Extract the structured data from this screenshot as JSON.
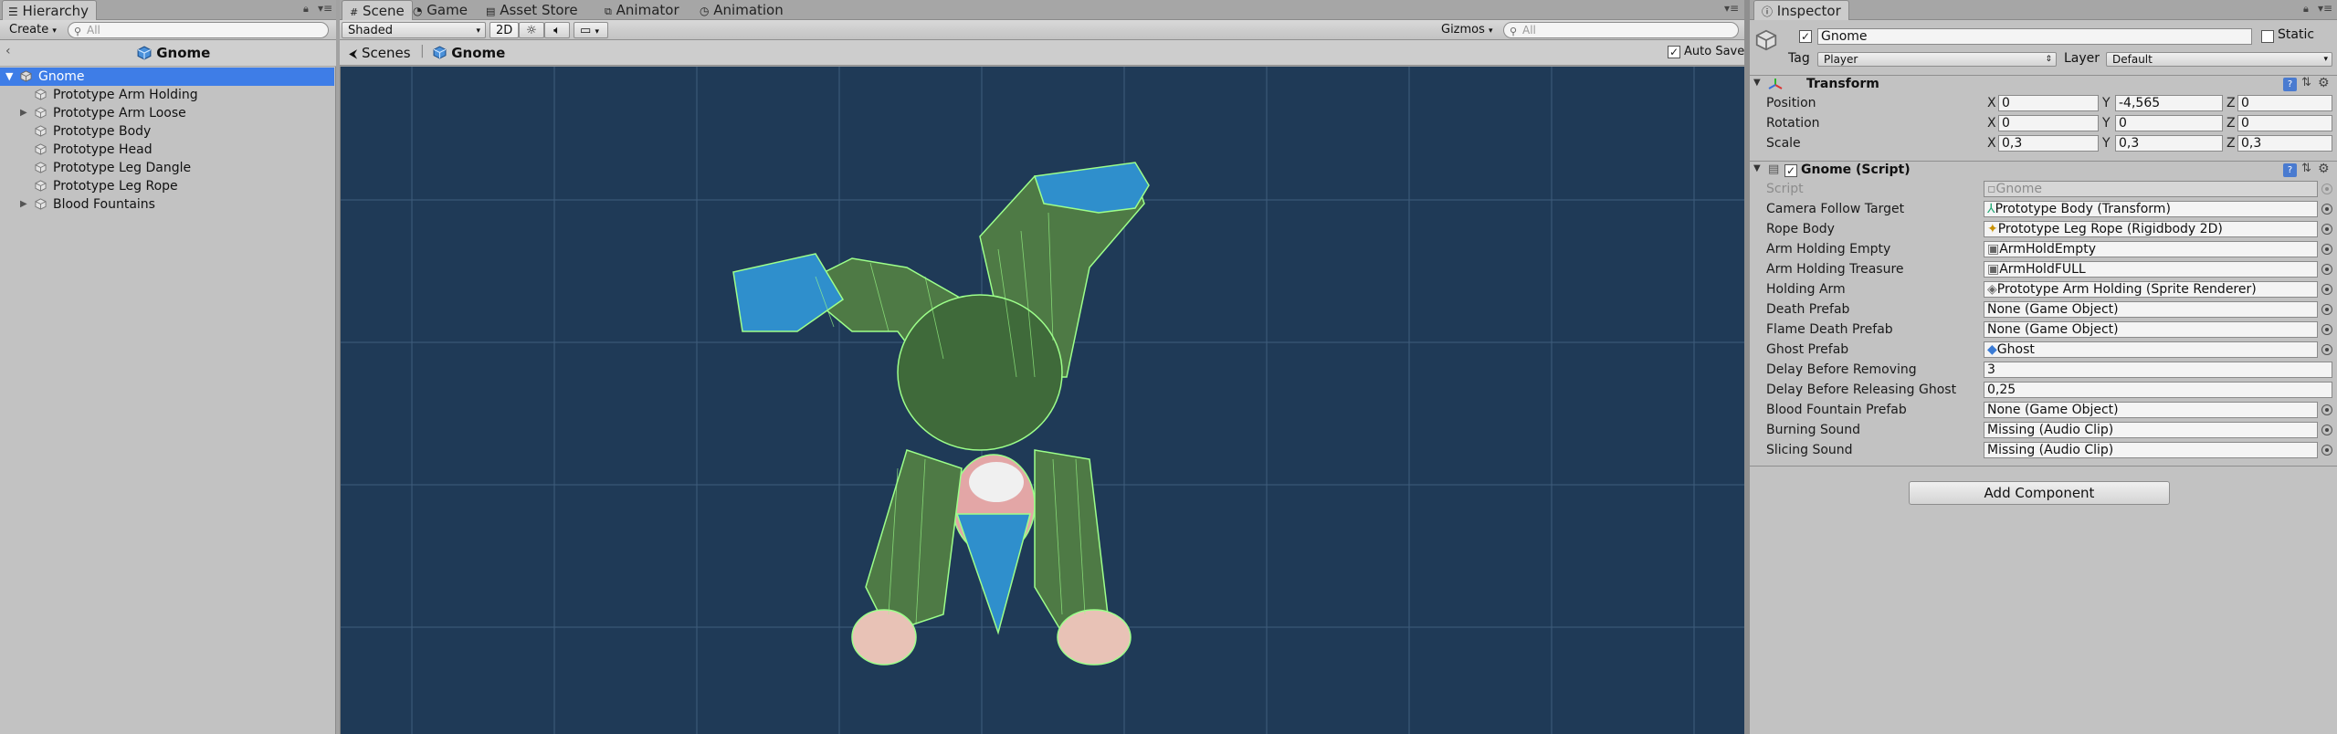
{
  "hierarchy": {
    "tab_label": "Hierarchy",
    "create_label": "Create",
    "search_placeholder": "All",
    "scene_name": "Gnome",
    "items": [
      {
        "label": "Gnome",
        "expanded": true,
        "selected": true
      },
      {
        "label": "Prototype Arm Holding"
      },
      {
        "label": "Prototype Arm Loose",
        "has_children": true
      },
      {
        "label": "Prototype Body"
      },
      {
        "label": "Prototype Head"
      },
      {
        "label": "Prototype Leg Dangle"
      },
      {
        "label": "Prototype Leg Rope"
      },
      {
        "label": "Blood Fountains",
        "has_children": true
      }
    ]
  },
  "scene_tabs": [
    {
      "label": "Scene",
      "icon": "grid-icon",
      "active": true
    },
    {
      "label": "Game",
      "icon": "pacman-icon"
    },
    {
      "label": "Asset Store",
      "icon": "store-icon"
    },
    {
      "label": "Animator",
      "icon": "animator-icon"
    },
    {
      "label": "Animation",
      "icon": "clock-icon"
    }
  ],
  "scene_toolbar": {
    "shading_mode": "Shaded",
    "mode_2d": "2D",
    "gizmos": "Gizmos",
    "search_placeholder": "All"
  },
  "breadcrumb": {
    "root": "Scenes",
    "current": "Gnome",
    "auto_save_label": "Auto Save",
    "auto_save_checked": true
  },
  "inspector": {
    "tab_label": "Inspector",
    "object_name": "Gnome",
    "static_label": "Static",
    "tag_label": "Tag",
    "tag_value": "Player",
    "layer_label": "Layer",
    "layer_value": "Default",
    "transform": {
      "title": "Transform",
      "rows": [
        {
          "label": "Position",
          "x": "0",
          "y": "-4,565",
          "z": "0"
        },
        {
          "label": "Rotation",
          "x": "0",
          "y": "0",
          "z": "0"
        },
        {
          "label": "Scale",
          "x": "0,3",
          "y": "0,3",
          "z": "0,3"
        }
      ],
      "axis_x": "X",
      "axis_y": "Y",
      "axis_z": "Z"
    },
    "script_component": {
      "title": "Gnome (Script)",
      "properties": [
        {
          "label": "Script",
          "value": "Gnome",
          "disabled": true
        },
        {
          "label": "Camera Follow Target",
          "value": "Prototype Body (Transform)"
        },
        {
          "label": "Rope Body",
          "value": "Prototype Leg Rope (Rigidbody 2D)"
        },
        {
          "label": "Arm Holding Empty",
          "value": "ArmHoldEmpty"
        },
        {
          "label": "Arm Holding Treasure",
          "value": "ArmHoldFULL"
        },
        {
          "label": "Holding Arm",
          "value": "Prototype Arm Holding (Sprite Renderer)"
        },
        {
          "label": "Death Prefab",
          "value": "None (Game Object)"
        },
        {
          "label": "Flame Death Prefab",
          "value": "None (Game Object)"
        },
        {
          "label": "Ghost Prefab",
          "value": "Ghost"
        },
        {
          "label": "Delay Before Removing",
          "value": "3"
        },
        {
          "label": "Delay Before Releasing Ghost",
          "value": "0,25"
        },
        {
          "label": "Blood Fountain Prefab",
          "value": "None (Game Object)"
        },
        {
          "label": "Burning Sound",
          "value": "Missing (Audio Clip)"
        },
        {
          "label": "Slicing Sound",
          "value": "Missing (Audio Clip)"
        }
      ]
    },
    "add_component_label": "Add Component"
  },
  "colors": {
    "scene_bg": "#1f3a57",
    "grid_line": "#3f5d7c",
    "selection": "#3e7de7",
    "collider": "#9dff8a"
  }
}
